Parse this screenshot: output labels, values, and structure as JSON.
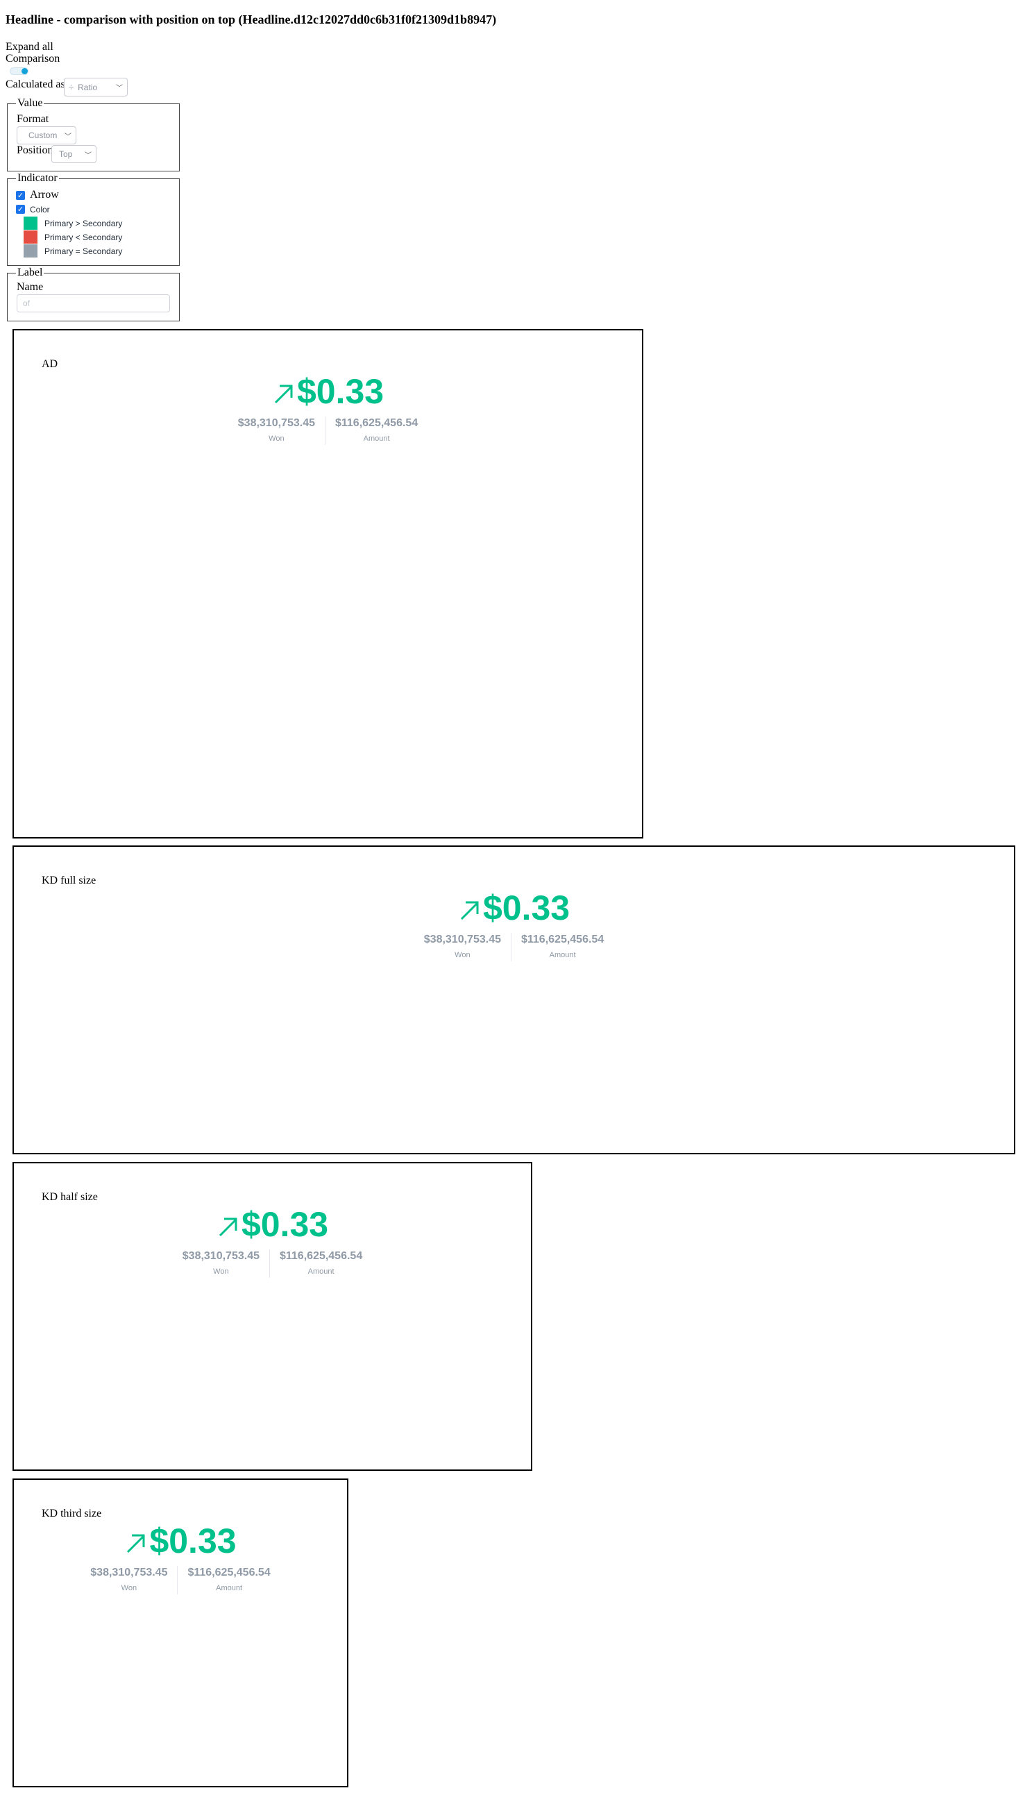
{
  "title": "Headline - comparison with position on top (Headline.d12c12027dd0c6b31f0f21309d1b8947)",
  "controls": {
    "expand_all": "Expand all",
    "comparison": "Comparison",
    "calculated_as_label": "Calculated as",
    "calculated_as_value": "Ratio",
    "calculated_as_icon": "divide-icon"
  },
  "value_group": {
    "legend": "Value",
    "format_label": "Format",
    "format_value": "Custom",
    "position_label": "Position",
    "position_value": "Top"
  },
  "indicator_group": {
    "legend": "Indicator",
    "arrow_label": "Arrow",
    "color_label": "Color",
    "rules": [
      {
        "label": "Primary > Secondary",
        "color": "#00c08b"
      },
      {
        "label": "Primary < Secondary",
        "color": "#e54d42"
      },
      {
        "label": "Primary = Secondary",
        "color": "#94a1ad"
      }
    ]
  },
  "label_group": {
    "legend": "Label",
    "name_label": "Name",
    "name_placeholder": "of"
  },
  "headline": {
    "primary_value": "$0.33",
    "primary_color": "#00c08b",
    "secondary_color": "#8f9aa6",
    "won_value": "$38,310,753.45",
    "won_label": "Won",
    "amount_value": "$116,625,456.54",
    "amount_label": "Amount"
  },
  "panels": [
    {
      "label": "AD"
    },
    {
      "label": "KD full size"
    },
    {
      "label": "KD half size"
    },
    {
      "label": "KD third size"
    }
  ]
}
